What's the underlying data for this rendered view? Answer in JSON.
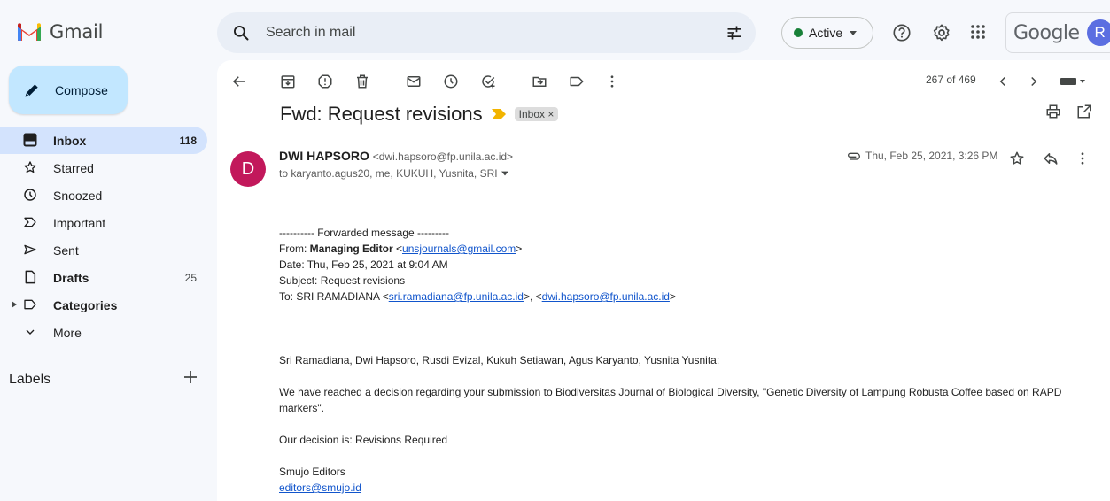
{
  "brand": {
    "name": "Gmail",
    "google": "Google",
    "avatar_letter": "R"
  },
  "search": {
    "placeholder": "Search in mail"
  },
  "status": {
    "label": "Active"
  },
  "compose": {
    "label": "Compose"
  },
  "sidebar": {
    "items": [
      {
        "label": "Inbox",
        "count": "118",
        "icon": "inbox-icon"
      },
      {
        "label": "Starred",
        "count": "",
        "icon": "star-icon"
      },
      {
        "label": "Snoozed",
        "count": "",
        "icon": "clock-icon"
      },
      {
        "label": "Important",
        "count": "",
        "icon": "important-icon"
      },
      {
        "label": "Sent",
        "count": "",
        "icon": "send-icon"
      },
      {
        "label": "Drafts",
        "count": "25",
        "icon": "draft-icon"
      },
      {
        "label": "Categories",
        "count": "",
        "icon": "label-icon"
      },
      {
        "label": "More",
        "count": "",
        "icon": "chevron-down-icon"
      }
    ],
    "labels_header": "Labels"
  },
  "toolbar": {
    "pager": "267 of 469"
  },
  "message": {
    "subject": "Fwd: Request revisions",
    "chip": "Inbox",
    "chip_close": "×",
    "sender_initial": "D",
    "sender_name": "DWI HAPSORO",
    "sender_email": "<dwi.hapsoro@fp.unila.ac.id>",
    "to": "to karyanto.agus20, me, KUKUH, Yusnita, SRI",
    "date": "Thu, Feb 25, 2021, 3:26 PM",
    "body": {
      "fwd_header": "---------- Forwarded message ---------",
      "from_label": "From: ",
      "from_name": "Managing Editor",
      "from_email": "unsjournals@gmail.com",
      "date_line": "Date: Thu, Feb 25, 2021 at 9:04 AM",
      "subject_line": "Subject: Request revisions",
      "to_label": "To: SRI RAMADIANA <",
      "to_email1": "sri.ramadiana@fp.unila.ac.id",
      "to_email2": "dwi.hapsoro@fp.unila.ac.id",
      "names": "Sri Ramadiana, Dwi Hapsoro, Rusdi Evizal, Kukuh Setiawan, Agus Karyanto, Yusnita Yusnita:",
      "p1": "We have reached a decision regarding your submission to Biodiversitas Journal of Biological Diversity, \"Genetic Diversity of Lampung Robusta Coffee based on RAPD markers\".",
      "p2": "Our decision is: Revisions Required",
      "signature": "Smujo Editors",
      "signature_email": "editors@smujo.id"
    }
  }
}
